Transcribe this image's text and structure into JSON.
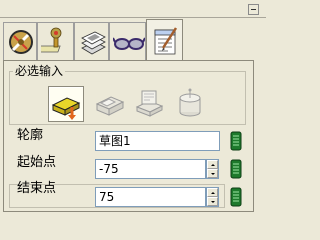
{
  "tabs": [
    {
      "icon": "feature-manager-icon",
      "active": false
    },
    {
      "icon": "property-manager-icon",
      "active": false
    },
    {
      "icon": "configuration-manager-icon",
      "active": false
    },
    {
      "icon": "display-manager-icon",
      "active": false
    },
    {
      "icon": "notes-icon",
      "active": true
    }
  ],
  "group": {
    "title": "必选输入",
    "tools": [
      {
        "icon": "extrude-feature-icon",
        "selected": true
      },
      {
        "icon": "revolve-feature-icon",
        "selected": false
      },
      {
        "icon": "sweep-feature-icon",
        "selected": false
      },
      {
        "icon": "loft-feature-icon",
        "selected": false
      }
    ]
  },
  "fields": {
    "profile": {
      "label": "轮廓",
      "value": "草图1"
    },
    "start": {
      "label": "起始点",
      "value": "-75"
    },
    "end": {
      "label": "结束点",
      "value": "75"
    }
  },
  "colors": {
    "background": "#ece9d8",
    "selector_green": "#1e7a2c",
    "field_border": "#7f9db9"
  }
}
